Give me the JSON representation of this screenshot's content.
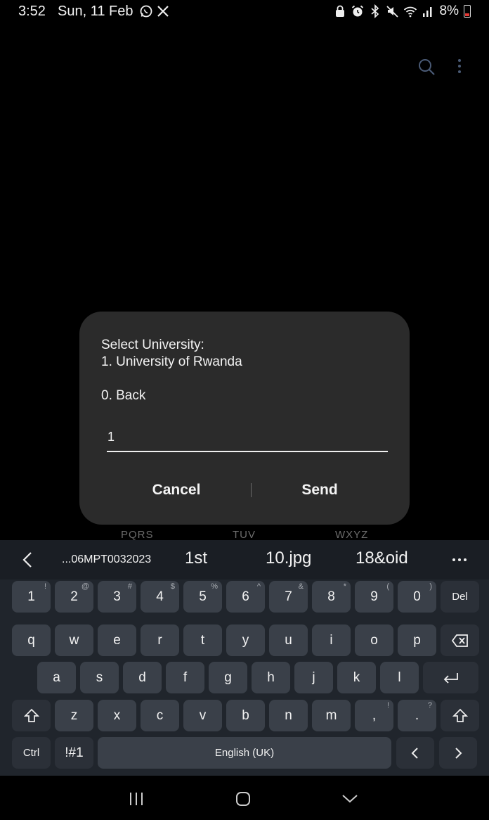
{
  "status_bar": {
    "time": "3:52",
    "date": "Sun, 11 Feb",
    "notification_icons": [
      "whatsapp-icon",
      "x-icon"
    ],
    "system_icons": [
      "lock-icon",
      "alarm-icon",
      "bluetooth-icon",
      "mute-icon",
      "wifi-icon",
      "signal-icon"
    ],
    "battery": "8%"
  },
  "app_bar": {
    "icons": [
      "search-icon",
      "more-vert-icon"
    ]
  },
  "dialog": {
    "message": "Select University:\n1. University of Rwanda\n\n0. Back",
    "input_value": "1",
    "cancel_label": "Cancel",
    "send_label": "Send"
  },
  "dialpad_hint": {
    "letters": [
      "PQRS",
      "TUV",
      "WXYZ"
    ]
  },
  "keyboard": {
    "suggestions": [
      "...06MPT0032023",
      "1st",
      "10.jpg",
      "18&oid"
    ],
    "rows": [
      [
        {
          "label": "1",
          "sup": "!"
        },
        {
          "label": "2",
          "sup": "@"
        },
        {
          "label": "3",
          "sup": "#"
        },
        {
          "label": "4",
          "sup": "$"
        },
        {
          "label": "5",
          "sup": "%"
        },
        {
          "label": "6",
          "sup": "^"
        },
        {
          "label": "7",
          "sup": "&"
        },
        {
          "label": "8",
          "sup": "*"
        },
        {
          "label": "9",
          "sup": "("
        },
        {
          "label": "0",
          "sup": ")"
        },
        {
          "label": "Del",
          "sup": ""
        }
      ],
      [
        {
          "label": "q"
        },
        {
          "label": "w"
        },
        {
          "label": "e"
        },
        {
          "label": "r"
        },
        {
          "label": "t"
        },
        {
          "label": "y"
        },
        {
          "label": "u"
        },
        {
          "label": "i"
        },
        {
          "label": "o"
        },
        {
          "label": "p"
        }
      ],
      [
        {
          "label": "a"
        },
        {
          "label": "s"
        },
        {
          "label": "d"
        },
        {
          "label": "f"
        },
        {
          "label": "g"
        },
        {
          "label": "h"
        },
        {
          "label": "j"
        },
        {
          "label": "k"
        },
        {
          "label": "l"
        }
      ],
      [
        {
          "label": "z"
        },
        {
          "label": "x"
        },
        {
          "label": "c"
        },
        {
          "label": "v"
        },
        {
          "label": "b"
        },
        {
          "label": "n"
        },
        {
          "label": "m"
        },
        {
          "label": ",",
          "sup": "!"
        },
        {
          "label": ".",
          "sup": "?"
        }
      ]
    ],
    "ctrl_label": "Ctrl",
    "symbols_label": "!#1",
    "space_label": "English (UK)",
    "icons": [
      "backspace-icon",
      "enter-icon",
      "shift-icon",
      "arrow-left-icon",
      "arrow-right-icon"
    ]
  },
  "nav_bar": {
    "icons": [
      "recent-apps-icon",
      "home-icon",
      "hide-keyboard-icon"
    ]
  }
}
